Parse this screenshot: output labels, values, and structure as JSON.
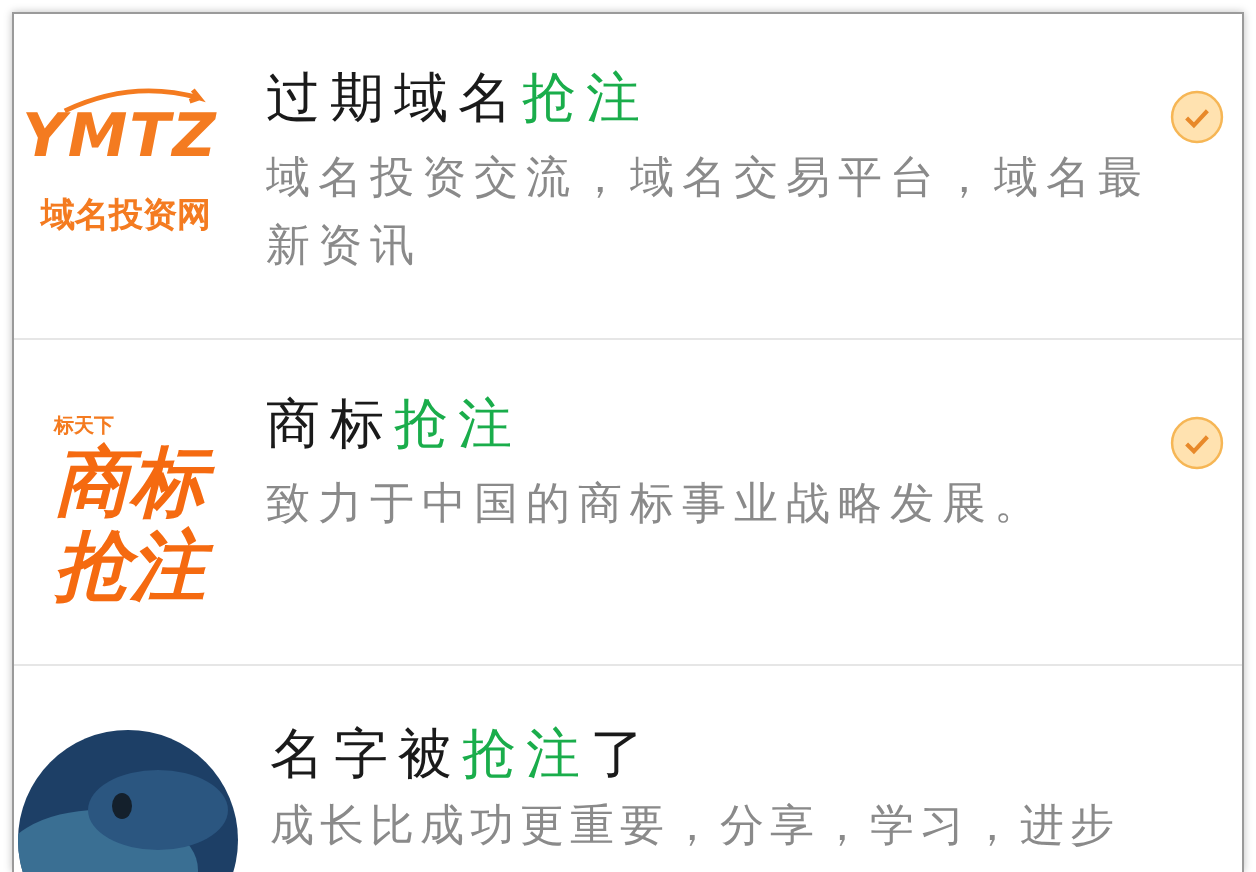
{
  "results": [
    {
      "logo": {
        "kind": "ymtz",
        "lines": [
          "YMTZ",
          "域名投资网"
        ]
      },
      "title": [
        {
          "text": "过期域名",
          "highlight": false
        },
        {
          "text": "抢注",
          "highlight": true
        }
      ],
      "description": "域名投资交流，域名交易平台，域名最新资讯",
      "verified": true
    },
    {
      "logo": {
        "kind": "trademark",
        "lines": [
          "标天下",
          "商标",
          "抢注"
        ]
      },
      "title": [
        {
          "text": "商标",
          "highlight": false
        },
        {
          "text": "抢注",
          "highlight": true
        }
      ],
      "description": "致力于中国的商标事业战略发展。",
      "verified": true
    },
    {
      "title": [
        {
          "text": "名字被",
          "highlight": false
        },
        {
          "text": "抢注",
          "highlight": true
        },
        {
          "text": "了",
          "highlight": false
        }
      ],
      "description": "成长比成功更重要，分享，学习，进步",
      "verified": false
    }
  ]
}
